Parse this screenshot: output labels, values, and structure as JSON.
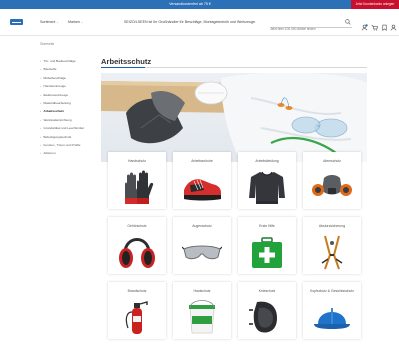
{
  "topbar": {
    "text": "Versandkostenfrei ab 75 €",
    "badge": "Jetzt Kundenkonto anlegen"
  },
  "header": {
    "nav": [
      {
        "label": "Sortiment"
      },
      {
        "label": "Marken"
      }
    ],
    "slogan": "SEIZO/LSEEN ist Ihr Großhändler für Beschläge, Montagetechnik und Werkzeuge.",
    "search_placeholder": "Jetzt über 100.000 Artikel finden",
    "icons": [
      "search-icon",
      "user-icon",
      "cart-icon",
      "bookmark-icon",
      "account-icon"
    ],
    "accent_color": "#2c71b8"
  },
  "breadcrumb": "Startseite",
  "sidebar": {
    "items": [
      {
        "label": "Tür- und Baubeschläge",
        "active": false
      },
      {
        "label": "Baustoffe",
        "active": false
      },
      {
        "label": "Möbelbeschläge",
        "active": false
      },
      {
        "label": "Handwerkzeuge",
        "active": false
      },
      {
        "label": "Elektrowerkzeuge",
        "active": false
      },
      {
        "label": "Materialbearbeitung",
        "active": false
      },
      {
        "label": "Arbeitsschutz",
        "active": true
      },
      {
        "label": "Werkstatteinrichtung",
        "active": false
      },
      {
        "label": "Grundartikel und Leuchtmittel",
        "active": false
      },
      {
        "label": "Befestigungstechnik",
        "active": false
      },
      {
        "label": "Fenster-, Türen und Profile",
        "active": false
      },
      {
        "label": "Aktionen",
        "active": false
      }
    ]
  },
  "page": {
    "title": "Arbeitsschutz",
    "accent_color": "#1c5fa8"
  },
  "categories": [
    {
      "label": "Handschutz",
      "icon": "glove-icon"
    },
    {
      "label": "Arbeitsschuhe",
      "icon": "safety-shoe-icon"
    },
    {
      "label": "Arbeitskleidung",
      "icon": "sweater-icon"
    },
    {
      "label": "Atemschutz",
      "icon": "respirator-icon"
    },
    {
      "label": "Gehörschutz",
      "icon": "earmuff-icon"
    },
    {
      "label": "Augenschutz",
      "icon": "safety-glasses-icon"
    },
    {
      "label": "Erste Hilfe",
      "icon": "first-aid-kit-icon"
    },
    {
      "label": "Absturzsicherung",
      "icon": "harness-icon"
    },
    {
      "label": "Brandschutz",
      "icon": "fire-extinguisher-icon"
    },
    {
      "label": "Hautschutz",
      "icon": "skin-cream-bucket-icon"
    },
    {
      "label": "Knieschutz",
      "icon": "knee-pad-icon"
    },
    {
      "label": "Kopfschutz & Gesichtsschutz",
      "icon": "hard-hat-icon"
    }
  ]
}
